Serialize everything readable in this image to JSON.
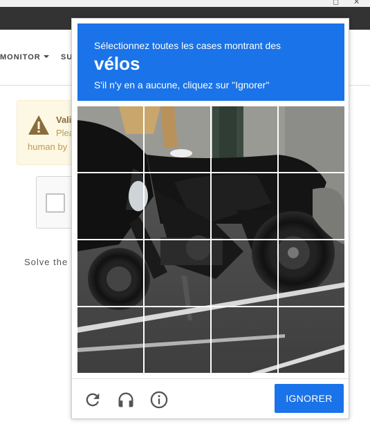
{
  "page": {
    "nav_items": [
      "MONITOR",
      "SU"
    ],
    "alert": {
      "title": "Vali",
      "line2": "Plea",
      "line3": "human by"
    },
    "solve_text": "Solve the p"
  },
  "challenge": {
    "instruction": "Sélectionnez toutes les cases montrant des",
    "target": "vélos",
    "subtext": "S'il n'y en a aucune, cliquez sur \"Ignorer\"",
    "grid": {
      "rows": 4,
      "cols": 4
    },
    "image_description": "motorcycle",
    "footer": {
      "icons": [
        "reload-icon",
        "headphones-icon",
        "info-icon"
      ],
      "skip_label": "IGNORER"
    }
  },
  "colors": {
    "accent": "#1a73e8",
    "warning_bg": "#fcf8e3",
    "warning_text": "#8a6d3b",
    "dark_bar": "#333333"
  }
}
